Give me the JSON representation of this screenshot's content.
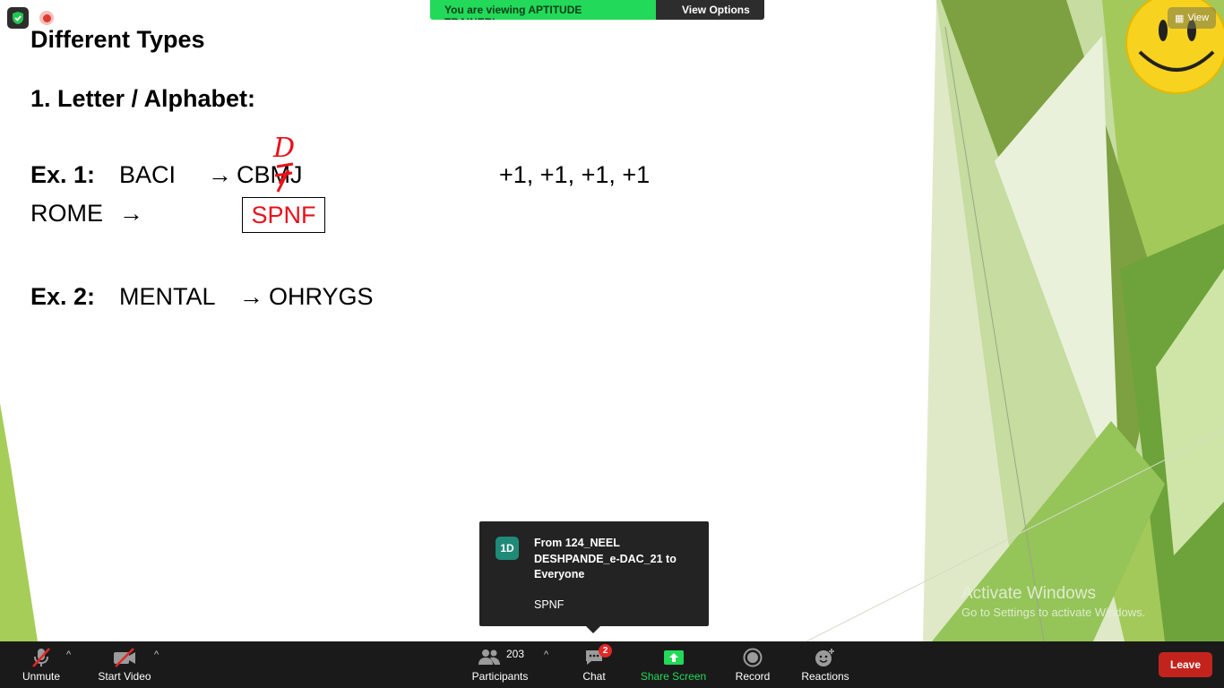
{
  "banner": {
    "viewing_text": "You are viewing APTITUDE TRAINER's screen",
    "view_options_label": "View Options"
  },
  "view_button": {
    "label": "View"
  },
  "slide": {
    "title": "Different Types",
    "subtitle": "1.  Letter / Alphabet:",
    "ex1": {
      "label": "Ex. 1:",
      "word": "BACI",
      "arrow": "→",
      "answer_start": "CB",
      "answer_struck": "M",
      "answer_end": "J",
      "annotation": "D",
      "pattern": "+1, +1, +1, +1"
    },
    "rome": {
      "word": "ROME",
      "arrow": "→",
      "boxed_answer": "SPNF"
    },
    "ex2": {
      "label": "Ex. 2:",
      "word": "MENTAL",
      "arrow": "→",
      "answer": "OHRYGS"
    }
  },
  "chat_popup": {
    "avatar_initials": "1D",
    "from_text": "From 124_NEEL DESHPANDE_e-DAC_21 to Everyone",
    "message": "SPNF"
  },
  "watermark": {
    "line1": "Activate Windows",
    "line2": "Go to Settings to activate Windows."
  },
  "toolbar": {
    "unmute": "Unmute",
    "start_video": "Start Video",
    "participants": "Participants",
    "participants_count": "203",
    "chat": "Chat",
    "chat_badge": "2",
    "share_screen": "Share Screen",
    "record": "Record",
    "reactions": "Reactions",
    "leave": "Leave"
  },
  "colors": {
    "banner_green": "#23d959",
    "toolbar_bg": "#1a1a1a",
    "leave_red": "#c2241d",
    "annotation_red": "#e8101a"
  }
}
